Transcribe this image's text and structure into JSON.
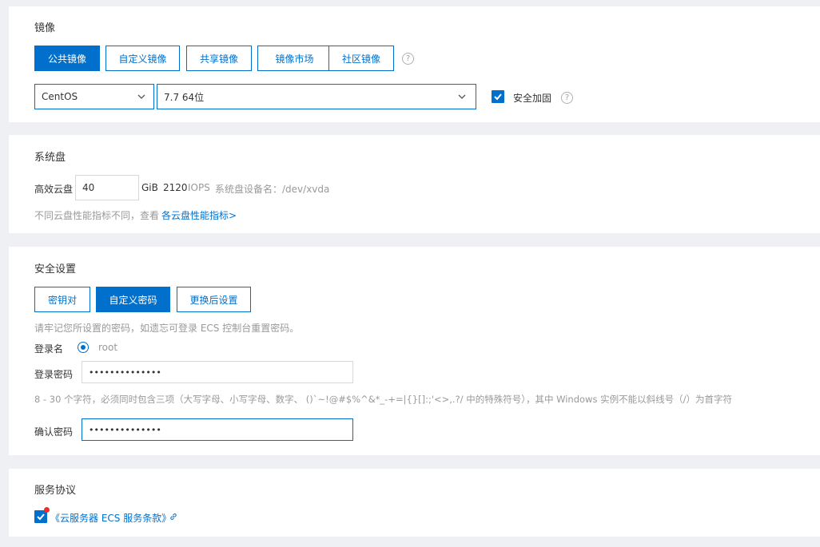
{
  "image": {
    "title": "镜像",
    "tabs": [
      "公共镜像",
      "自定义镜像",
      "共享镜像",
      "镜像市场",
      "社区镜像"
    ],
    "os_value": "CentOS",
    "version_value": "7.7 64位",
    "hardening_label": "安全加固"
  },
  "system_disk": {
    "title": "系统盘",
    "type_label": "高效云盘",
    "size_value": "40",
    "unit": "GiB",
    "iops_value": "2120",
    "iops_label": "IOPS",
    "device_label": "系统盘设备名：/dev/xvda",
    "hint": "不同云盘性能指标不同，查看",
    "hint_link": "各云盘性能指标>"
  },
  "security": {
    "title": "安全设置",
    "tabs": [
      "密钥对",
      "自定义密码",
      "更换后设置"
    ],
    "notice": "请牢记您所设置的密码，如遗忘可登录 ECS 控制台重置密码。",
    "login_name_label": "登录名",
    "login_name_value": "root",
    "password_label": "登录密码",
    "password_value": "••••••••••••••",
    "password_rule": "8 - 30 个字符，必须同时包含三项（大写字母、小写字母、数字、 ()`~!@#$%^&*_-+=|{}[]:;'<>,.?/ 中的特殊符号），其中 Windows 实例不能以斜线号（/）为首字符",
    "confirm_label": "确认密码",
    "confirm_value": "••••••••••••••"
  },
  "agreement": {
    "title": "服务协议",
    "link": "《云服务器 ECS 服务条款》"
  },
  "colors": {
    "primary": "#0070cc",
    "background": "#eef0f3",
    "required_dot": "#e8312b"
  }
}
